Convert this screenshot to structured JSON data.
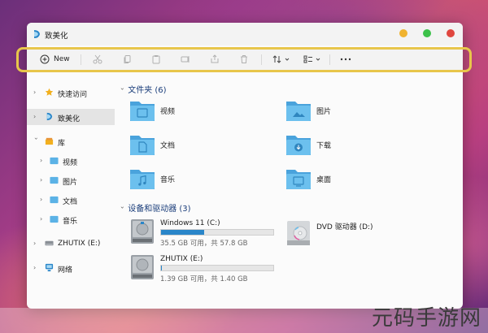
{
  "window": {
    "title": "致美化"
  },
  "toolbar": {
    "new_label": "New",
    "buttons": [
      "cut-icon",
      "copy-icon",
      "paste-icon",
      "rename-icon",
      "share-icon",
      "delete-icon",
      "sort-icon",
      "view-icon",
      "more-icon"
    ]
  },
  "sidebar": {
    "items": [
      {
        "label": "快速访问"
      },
      {
        "label": "致美化"
      },
      {
        "label": "库"
      },
      {
        "label": "视频"
      },
      {
        "label": "图片"
      },
      {
        "label": "文档"
      },
      {
        "label": "音乐"
      },
      {
        "label": "ZHUTIX (E:)"
      },
      {
        "label": "网络"
      }
    ]
  },
  "main": {
    "folders_header": "文件夹 (6)",
    "folders": [
      {
        "label": "视频"
      },
      {
        "label": "图片"
      },
      {
        "label": "文档"
      },
      {
        "label": "下载"
      },
      {
        "label": "音乐"
      },
      {
        "label": "桌面"
      }
    ],
    "drives_header": "设备和驱动器 (3)",
    "drives": [
      {
        "name": "Windows 11 (C:)",
        "info": "35.5 GB 可用，共 57.8 GB",
        "used_fraction": 0.386
      },
      {
        "name": "ZHUTIX (E:)",
        "info": "1.39 GB 可用，共 1.40 GB",
        "used_fraction": 0.007
      },
      {
        "name": "DVD 驱动器 (D:)"
      }
    ]
  },
  "colors": {
    "accent": "#2a86c9",
    "folder": "#5bb2e6",
    "highlight": "#e8c64b",
    "close": "#e0473f",
    "minimize": "#f0b330",
    "maximize": "#3cc14a"
  },
  "watermark": {
    "text": "元码手游网"
  }
}
